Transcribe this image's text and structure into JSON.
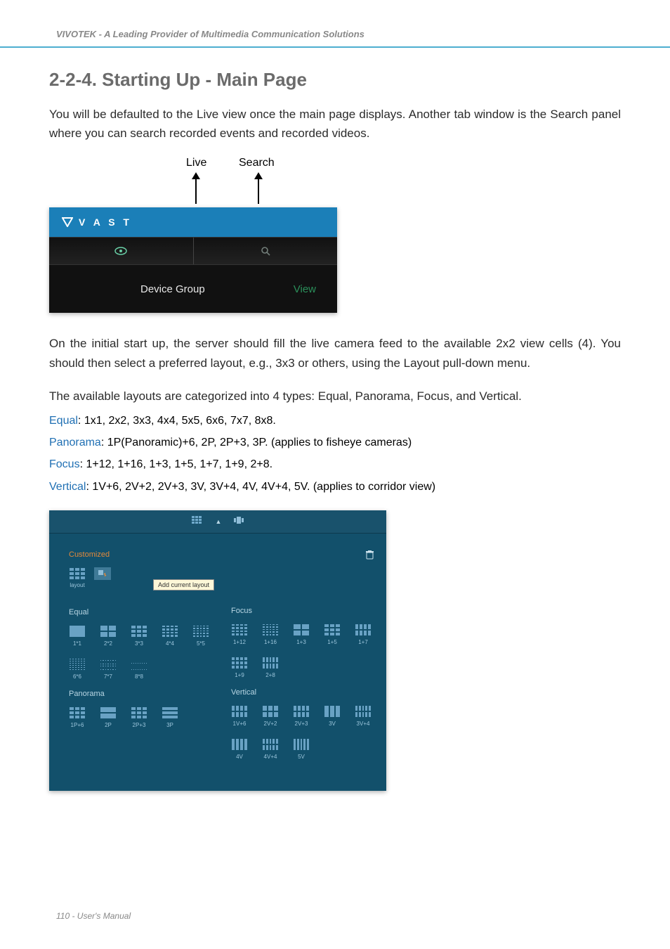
{
  "header": "VIVOTEK - A Leading Provider of Multimedia Communication Solutions",
  "title": "2-2-4. Starting Up - Main Page",
  "p1": "You will be defaulted to the Live view once the main page displays. Another tab window is the Search panel where you can search recorded events and recorded videos.",
  "fig1": {
    "label_live": "Live",
    "label_search": "Search",
    "logo_text": "V A S T",
    "dg": "Device Group",
    "view": "View"
  },
  "p2": "On the initial start up, the server should fill the live camera feed to the available 2x2 view cells (4). You should then select a preferred layout, e.g., 3x3 or others, using the Layout pull-down menu.",
  "p3": "The available layouts are categorized into 4 types: Equal, Panorama, Focus, and Vertical.",
  "layouts": {
    "equal_k": "Equal",
    "equal_v": ": 1x1, 2x2, 3x3, 4x4, 5x5, 6x6, 7x7, 8x8.",
    "pan_k": "Panorama",
    "pan_v": ": 1P(Panoramic)+6, 2P, 2P+3, 3P. (applies to fisheye cameras)",
    "focus_k": "Focus",
    "focus_v": ": 1+12, 1+16, 1+3, 1+5, 1+7, 1+9, 2+8.",
    "vert_k": "Vertical",
    "vert_v": ": 1V+6, 2V+2, 2V+3, 3V, 3V+4, 4V, 4V+4, 5V. (applies to corridor view)"
  },
  "fig2": {
    "customized": "Customized",
    "layout_lbl": "layout",
    "tooltip_add": "Add current layout",
    "equal": "Equal",
    "panorama": "Panorama",
    "focus": "Focus",
    "vertical": "Vertical",
    "eq": [
      "1*1",
      "2*2",
      "3*3",
      "4*4",
      "5*5",
      "6*6",
      "7*7",
      "8*8"
    ],
    "pa": [
      "1P+6",
      "2P",
      "2P+3",
      "3P"
    ],
    "fo": [
      "1+12",
      "1+16",
      "1+3",
      "1+5",
      "1+7",
      "1+9",
      "2+8"
    ],
    "ve": [
      "1V+6",
      "2V+2",
      "2V+3",
      "3V",
      "3V+4",
      "4V",
      "4V+4",
      "5V"
    ]
  },
  "footer": "110 - User's Manual"
}
